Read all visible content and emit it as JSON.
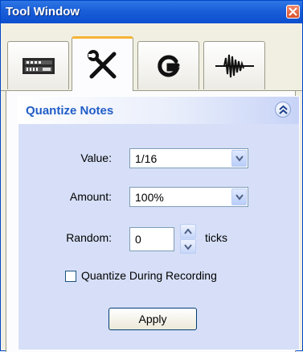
{
  "window": {
    "title": "Tool Window"
  },
  "tabs": [
    {
      "icon": "mixer-icon",
      "active": false
    },
    {
      "icon": "tools-icon",
      "active": true
    },
    {
      "icon": "g-logo-icon",
      "active": false
    },
    {
      "icon": "waveform-icon",
      "active": false
    }
  ],
  "panel": {
    "title": "Quantize Notes",
    "value_label": "Value:",
    "value_selected": "1/16",
    "amount_label": "Amount:",
    "amount_selected": "100%",
    "random_label": "Random:",
    "random_value": "0",
    "random_unit": "ticks",
    "checkbox_label": "Quantize During Recording",
    "checkbox_checked": false,
    "apply_label": "Apply"
  },
  "colors": {
    "titlebar": "#1a5ed8",
    "panel_title": "#215dc6",
    "active_tab_accent": "#f5b335",
    "panel_background": "#d6dff7"
  }
}
